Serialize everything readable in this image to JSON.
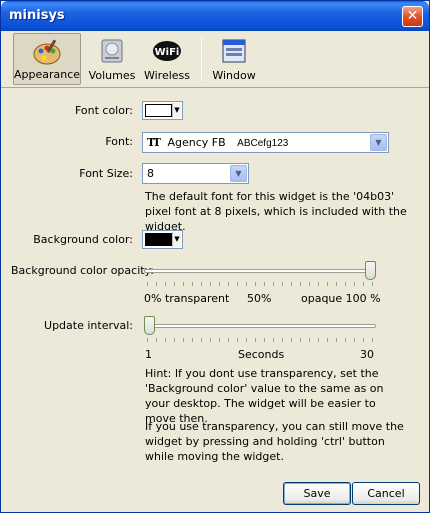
{
  "window": {
    "title": "minisys"
  },
  "toolbar": {
    "items": [
      {
        "label": "Appearance",
        "icon": "palette-icon",
        "active": true
      },
      {
        "label": "Volumes",
        "icon": "drive-icon",
        "active": false
      },
      {
        "label": "Wireless",
        "icon": "wifi-icon",
        "active": false
      },
      {
        "label": "Window",
        "icon": "window-icon",
        "active": false
      }
    ]
  },
  "appearance": {
    "font_color_label": "Font color:",
    "font_color_value": "#ffffff",
    "font_label": "Font:",
    "font_value": "Agency FB",
    "font_sample": "ABCefg123",
    "font_size_label": "Font Size:",
    "font_size_value": "8",
    "font_desc": "The default font for this widget is the '04b03' pixel font at 8 pixels, which is included with the widget.",
    "bg_color_label": "Background color:",
    "bg_color_value": "#000000",
    "opacity_label": "Background color opacity:",
    "opacity_value_percent": 100,
    "opacity_min": "0% transparent",
    "opacity_mid": "50%",
    "opacity_max": "opaque 100 %",
    "interval_label": "Update interval:",
    "interval_value": 1,
    "interval_min": "1",
    "interval_mid": "Seconds",
    "interval_max": "30",
    "hint1": "Hint: If you dont use transparency, set the 'Background color' value to the same as on your desktop. The widget will be easier to move then.",
    "hint2": "If you use transparency, you can still move the widget by pressing and holding 'ctrl' button while moving the widget."
  },
  "buttons": {
    "save": "Save",
    "cancel": "Cancel"
  },
  "colors": {
    "titlebar": "#0a4fd6",
    "background": "#ece9d8"
  }
}
